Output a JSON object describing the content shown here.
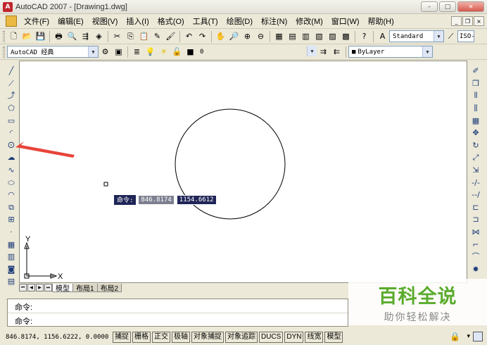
{
  "title": "AutoCAD 2007 - [Drawing1.dwg]",
  "window_controls": {
    "minimize": "–",
    "restore": "□",
    "close": "×"
  },
  "doc_controls": {
    "minimize": "_",
    "restore": "❐",
    "close": "×"
  },
  "menu": [
    "文件(F)",
    "编辑(E)",
    "视图(V)",
    "插入(I)",
    "格式(O)",
    "工具(T)",
    "绘图(D)",
    "标注(N)",
    "修改(M)",
    "窗口(W)",
    "帮助(H)"
  ],
  "toolbar1": {
    "icons": [
      "new-icon",
      "open-icon",
      "save-icon",
      "plot-icon",
      "plot-preview-icon",
      "publish-icon",
      "3d-icon",
      "cut-icon",
      "copy-icon",
      "paste-icon",
      "match-icon",
      "brush-icon",
      "undo-icon",
      "redo-icon",
      "pan-icon",
      "zoom-realtime-icon",
      "zoom-window-icon",
      "zoom-previous-icon",
      "properties-icon",
      "designcenter-icon",
      "tool-palettes-icon",
      "sheetset-icon",
      "markup-icon",
      "calculator-icon",
      "help-icon"
    ],
    "text_style_label": "Standard",
    "dim_style_label": "ISO-"
  },
  "toolbar2": {
    "workspace_label": "AutoCAD 经典",
    "layer_label": "0",
    "color_label": "ByLayer"
  },
  "left_tools": [
    "line-icon",
    "construction-line-icon",
    "polyline-icon",
    "polygon-icon",
    "rectangle-icon",
    "arc-icon",
    "circle-icon",
    "revcloud-icon",
    "spline-icon",
    "ellipse-icon",
    "ellipse-arc-icon",
    "insert-block-icon",
    "make-block-icon",
    "point-icon",
    "hatch-icon",
    "gradient-icon",
    "region-icon",
    "table-icon"
  ],
  "right_tools": [
    "erase-icon",
    "copy-object-icon",
    "mirror-icon",
    "offset-icon",
    "array-icon",
    "move-icon",
    "rotate-icon",
    "scale-icon",
    "stretch-icon",
    "trim-icon",
    "extend-icon",
    "break-at-point-icon",
    "break-icon",
    "join-icon",
    "chamfer-icon",
    "fillet-icon",
    "explode-icon"
  ],
  "ucs": {
    "x_label": "X",
    "y_label": "Y"
  },
  "dyn_input": {
    "label": "命令:",
    "x_value": "846.8174",
    "y_value": "1154.6612"
  },
  "tabs": [
    "模型",
    "布局1",
    "布局2"
  ],
  "command_lines": [
    "命令:",
    "命令:"
  ],
  "status": {
    "coords": "846.8174,  1156.6222, 0.0000",
    "buttons": [
      "捕捉",
      "栅格",
      "正交",
      "极轴",
      "对象捕捉",
      "对象追踪",
      "DUCS",
      "DYN",
      "线宽",
      "模型"
    ]
  },
  "watermark": {
    "main": "百科全说",
    "sub": "助你轻松解决"
  },
  "colors": {
    "arrow": "#e8443a",
    "dyn_bg": "#1f2557",
    "watermark_green": "#5aab2d"
  }
}
